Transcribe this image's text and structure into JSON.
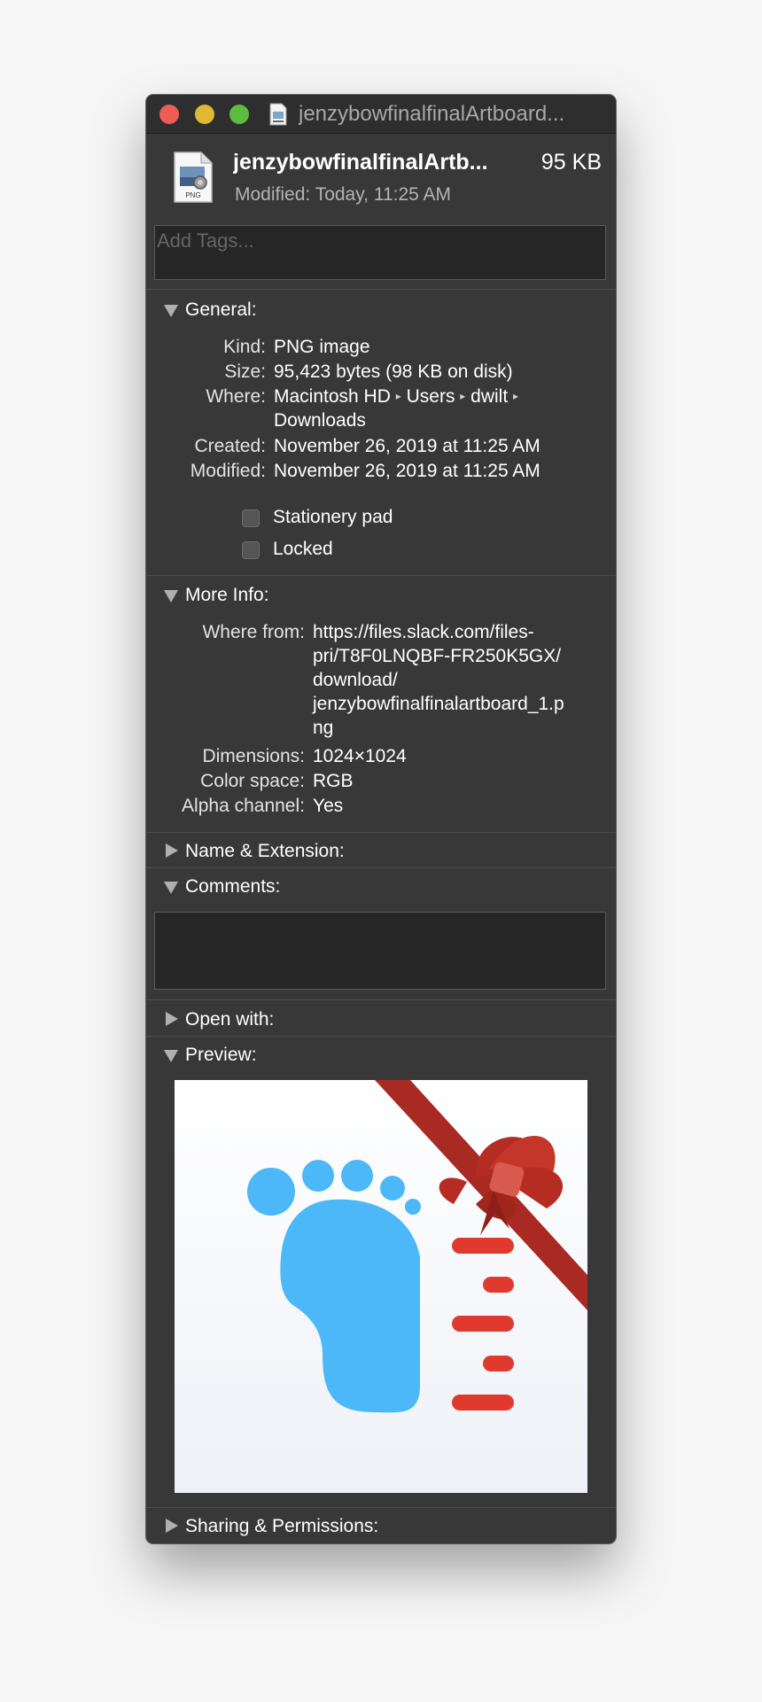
{
  "window": {
    "title": "jenzybowfinalfinalArtboard...",
    "header": {
      "filename": "jenzybowfinalfinalArtb...",
      "size": "95 KB",
      "modified_label": "Modified:",
      "modified_value": "Today, 11:25 AM",
      "icon_text": "PNG"
    },
    "tags": {
      "placeholder": "Add Tags..."
    }
  },
  "general": {
    "title": "General:",
    "rows": [
      {
        "label": "Kind:",
        "value": "PNG image"
      },
      {
        "label": "Size:",
        "value": "95,423 bytes (98 KB on disk)"
      },
      {
        "label": "Where:",
        "path": [
          "Macintosh HD",
          "Users",
          "dwilt",
          "Downloads"
        ],
        "separator": "▸"
      },
      {
        "label": "Created:",
        "value": "November 26, 2019 at 11:25 AM"
      },
      {
        "label": "Modified:",
        "value": "November 26, 2019 at 11:25 AM"
      }
    ],
    "checkboxes": [
      {
        "label": "Stationery pad",
        "checked": false
      },
      {
        "label": "Locked",
        "checked": false
      }
    ]
  },
  "more_info": {
    "title": "More Info:",
    "rows": [
      {
        "label": "Where from:",
        "lines": [
          "https://files.slack.com/files-",
          "pri/T8F0LNQBF-FR250K5GX/",
          "download/",
          "jenzybowfinalfinalartboard_1.p",
          "ng"
        ]
      },
      {
        "label": "Dimensions:",
        "value": "1024×1024"
      },
      {
        "label": "Color space:",
        "value": "RGB"
      },
      {
        "label": "Alpha channel:",
        "value": "Yes"
      }
    ]
  },
  "sections": {
    "name_extension": "Name & Extension:",
    "comments": "Comments:",
    "open_with": "Open with:",
    "preview": "Preview:",
    "sharing": "Sharing & Permissions:"
  },
  "colors": {
    "window_bg": "#383838",
    "foot_blue": "#4db8f8",
    "ribbon_red": "#a82a22",
    "ruler_red": "#e03a2e",
    "close": "#ee5d55",
    "minimize": "#e0b834",
    "zoom": "#5cbd42"
  }
}
